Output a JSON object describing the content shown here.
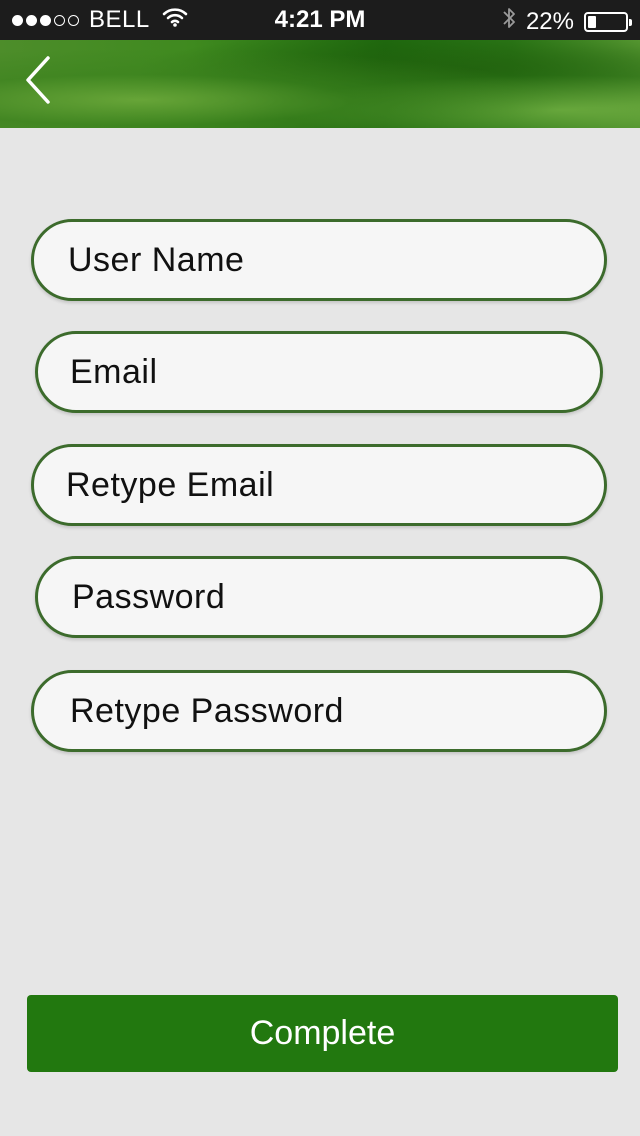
{
  "status_bar": {
    "carrier": "BELL",
    "time": "4:21 PM",
    "battery_percent": "22%",
    "battery_level": 0.22,
    "signal_bars_filled": 3,
    "signal_bars_total": 5,
    "icons": [
      "wifi-icon",
      "bluetooth-icon",
      "battery-icon"
    ]
  },
  "header": {
    "back_icon": "chevron-left-icon",
    "colors": {
      "banner_dark": "#1f6b0f",
      "banner_light": "#5a9c34"
    }
  },
  "form": {
    "fields": [
      {
        "name": "username",
        "placeholder": "User Name",
        "value": ""
      },
      {
        "name": "email",
        "placeholder": "Email",
        "value": ""
      },
      {
        "name": "retype_email",
        "placeholder": "Retype Email",
        "value": ""
      },
      {
        "name": "password",
        "placeholder": "Password",
        "value": ""
      },
      {
        "name": "retype_password",
        "placeholder": "Retype Password",
        "value": ""
      }
    ],
    "colors": {
      "field_border": "#3c6b2c",
      "field_background": "#f6f6f6"
    }
  },
  "complete_button": {
    "label": "Complete",
    "color": "#22780f"
  }
}
